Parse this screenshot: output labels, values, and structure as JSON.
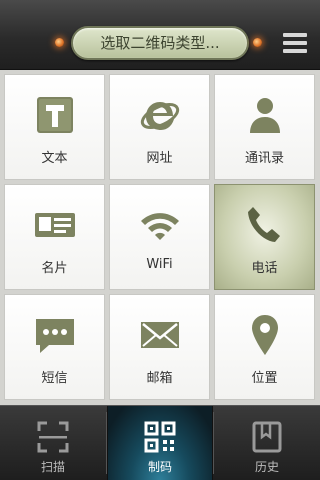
{
  "header": {
    "title": "选取二维码类型...",
    "menu_icon": "menu-icon",
    "indicator_color": "#e0762a"
  },
  "grid": {
    "items": [
      {
        "label": "文本",
        "icon": "text-icon"
      },
      {
        "label": "网址",
        "icon": "browser-icon"
      },
      {
        "label": "通讯录",
        "icon": "contact-icon"
      },
      {
        "label": "名片",
        "icon": "business-card-icon"
      },
      {
        "label": "WiFi",
        "icon": "wifi-icon"
      },
      {
        "label": "电话",
        "icon": "phone-icon",
        "selected": true
      },
      {
        "label": "短信",
        "icon": "sms-icon"
      },
      {
        "label": "邮箱",
        "icon": "mail-icon"
      },
      {
        "label": "位置",
        "icon": "location-pin-icon"
      }
    ],
    "icon_color": "#7d8360"
  },
  "tabbar": {
    "tabs": [
      {
        "label": "扫描",
        "icon": "scan-icon"
      },
      {
        "label": "制码",
        "icon": "qrcode-icon",
        "selected": true
      },
      {
        "label": "历史",
        "icon": "history-icon"
      }
    ]
  }
}
